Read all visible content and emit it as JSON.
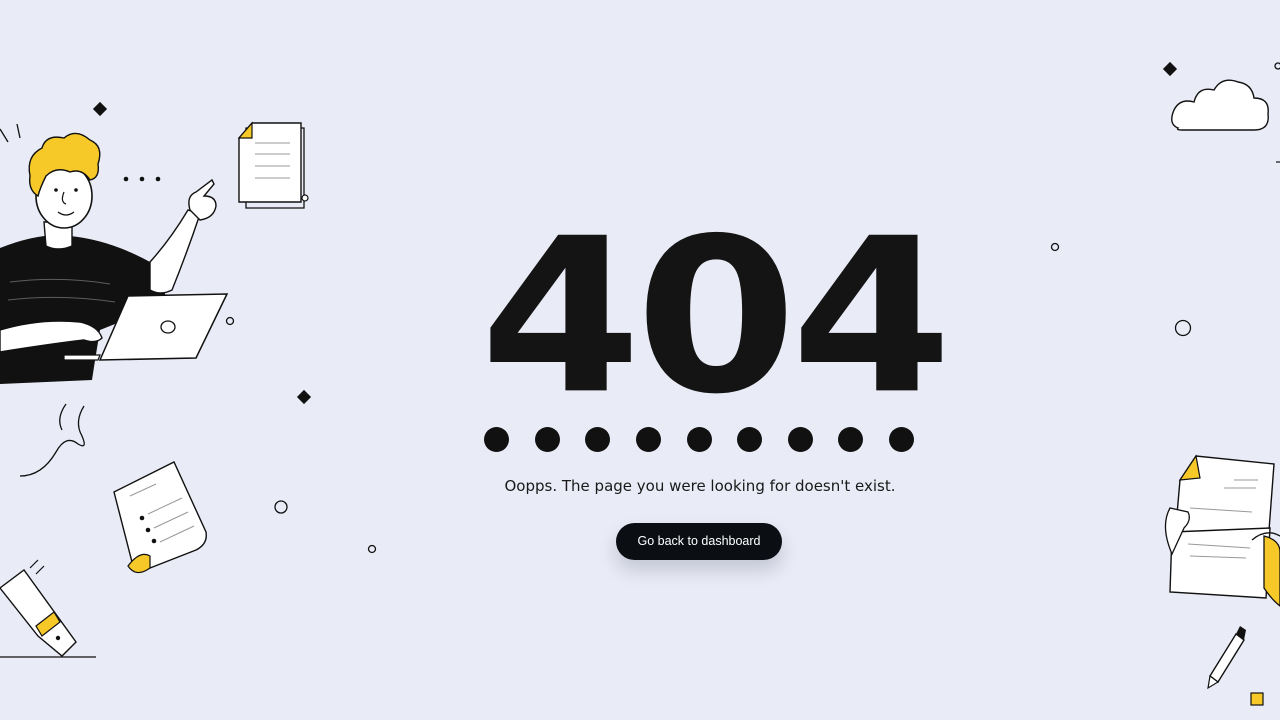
{
  "error": {
    "code": "404",
    "dot_count": 9,
    "message": "Oopps. The page you were looking for doesn't exist.",
    "button_label": "Go back to dashboard"
  },
  "colors": {
    "background": "#e9ebf6",
    "text": "#141414",
    "button_bg": "#0b0f14",
    "button_text": "#ffffff",
    "accent": "#f7c928"
  },
  "icons": [
    "person-laptop-illustration",
    "document-icon",
    "paper-note-icon",
    "pencil-icon",
    "cloud-icon",
    "person-holding-paper-illustration",
    "pen-icon"
  ]
}
